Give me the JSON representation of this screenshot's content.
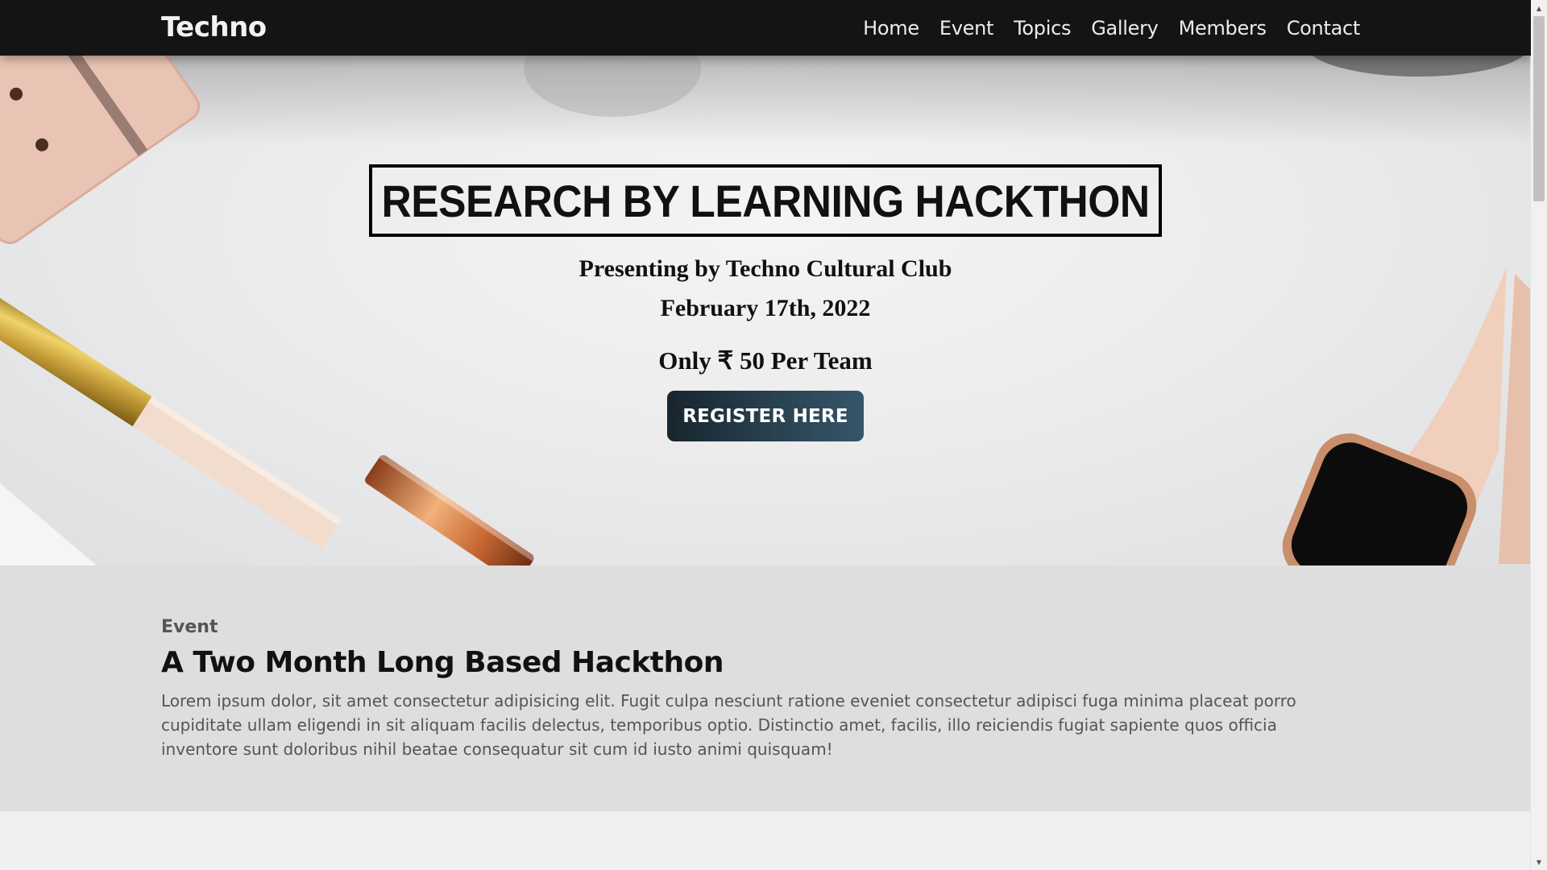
{
  "navbar": {
    "brand": "Techno",
    "links": [
      {
        "label": "Home"
      },
      {
        "label": "Event"
      },
      {
        "label": "Topics"
      },
      {
        "label": "Gallery"
      },
      {
        "label": "Members"
      },
      {
        "label": "Contact"
      }
    ]
  },
  "hero": {
    "title": "RESEARCH BY LEARNING HACKTHON",
    "subtitle": "Presenting by Techno Cultural Club",
    "date": "February 17th, 2022",
    "price": "Only ₹ 50 Per Team",
    "register_label": "REGISTER HERE"
  },
  "event": {
    "kicker": "Event",
    "title": "A Two Month Long Based Hackthon",
    "body": "Lorem ipsum dolor, sit amet consectetur adipisicing elit. Fugit culpa nesciunt ratione eveniet consectetur adipisci fuga minima placeat porro cupiditate ullam eligendi in sit aliquam facilis delectus, temporibus optio. Distinctio amet, facilis, illo reiciendis fugiat sapiente quos officia inventore sunt doloribus nihil beatae consequatur sit cum id iusto animi quisquam!"
  },
  "icons": {
    "scroll_up": "arrow-up-icon",
    "scroll_down": "arrow-down-icon"
  }
}
